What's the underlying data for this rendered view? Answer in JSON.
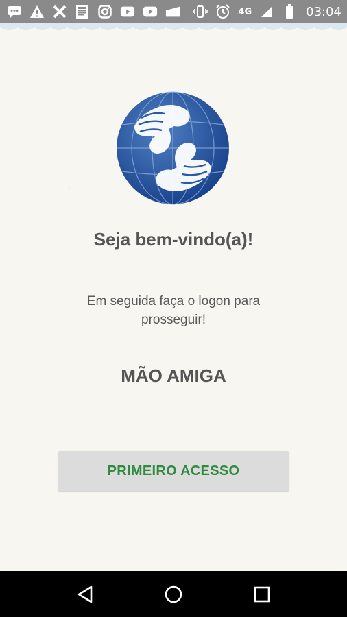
{
  "status_bar": {
    "network": "4G",
    "time": "03:04",
    "left_icons": [
      "chat-icon",
      "warning-icon",
      "x-icon",
      "news-icon",
      "instagram-icon",
      "youtube-icon",
      "youtube-icon",
      "card-icon"
    ],
    "right_icons": [
      "vibrate-icon",
      "alarm-icon",
      "signal-icon",
      "battery-icon"
    ]
  },
  "main": {
    "welcome": "Seja bem-vindo(a)!",
    "instruction": "Em seguida faça o logon para prosseguir!",
    "app_name": "MÃO AMIGA",
    "primary_button_label": "PRIMEIRO ACESSO"
  },
  "colors": {
    "status_bar": "#8a8a8a",
    "background": "#f7f6f1",
    "logo_blue": "#1f4f98",
    "button_bg": "#dcdcdc",
    "button_text": "#2e8b3f",
    "nav_bar": "#000000"
  },
  "navigation": {
    "icons": [
      "back-icon",
      "home-icon",
      "recents-icon"
    ]
  }
}
